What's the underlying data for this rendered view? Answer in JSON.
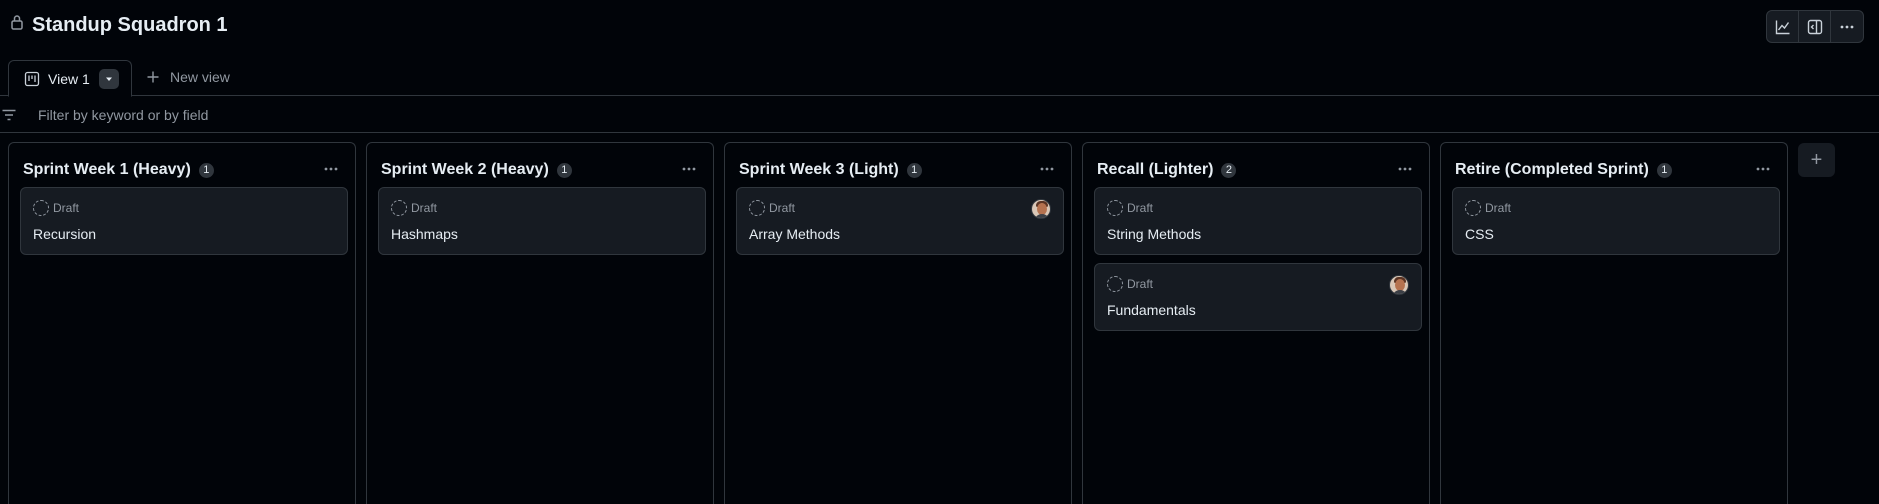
{
  "project": {
    "title": "Standup Squadron 1"
  },
  "toolbar": {
    "insights_icon": "graph-icon",
    "panel_icon": "sidebar-toggle-icon",
    "more_icon": "kebab-horizontal-icon"
  },
  "views": {
    "active_tab": "View 1",
    "new_view_label": "New view"
  },
  "filter": {
    "placeholder": "Filter by keyword or by field"
  },
  "columns": [
    {
      "title": "Sprint Week 1 (Heavy)",
      "count": "1",
      "cards": [
        {
          "status": "Draft",
          "title": "Recursion",
          "has_avatar": false
        }
      ]
    },
    {
      "title": "Sprint Week 2 (Heavy)",
      "count": "1",
      "cards": [
        {
          "status": "Draft",
          "title": "Hashmaps",
          "has_avatar": false
        }
      ]
    },
    {
      "title": "Sprint Week 3 (Light)",
      "count": "1",
      "cards": [
        {
          "status": "Draft",
          "title": "Array Methods",
          "has_avatar": true
        }
      ]
    },
    {
      "title": "Recall (Lighter)",
      "count": "2",
      "cards": [
        {
          "status": "Draft",
          "title": "String Methods",
          "has_avatar": false
        },
        {
          "status": "Draft",
          "title": "Fundamentals",
          "has_avatar": true
        }
      ]
    },
    {
      "title": "Retire (Completed Sprint)",
      "count": "1",
      "cards": [
        {
          "status": "Draft",
          "title": "CSS",
          "has_avatar": false
        }
      ]
    }
  ],
  "add_column": {
    "label": "+"
  },
  "colors": {
    "background": "#010409",
    "card": "#161b22",
    "border": "#30363d",
    "text": "#e6edf3",
    "muted": "#9198a1"
  }
}
